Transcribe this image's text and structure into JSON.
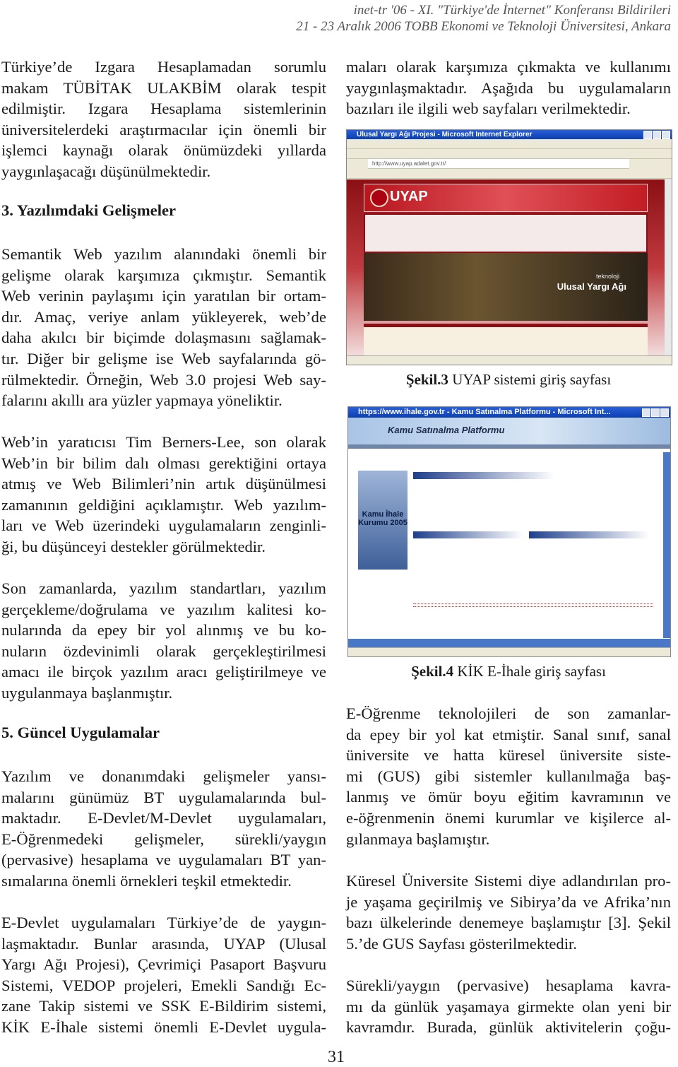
{
  "header": {
    "line1": "inet-tr '06 - XI. \"Türkiye'de İnternet\" Konferansı Bildirileri",
    "line2": "21 - 23 Aralık 2006  TOBB Ekonomi ve Teknoloji Üniversitesi, Ankara"
  },
  "left": {
    "p1": [
      "Türkiye’de Izgara Hesaplamadan sorumlu",
      "makam TÜBİTAK ULAKBİM olarak tespit",
      "edilmiştir. Izgara Hesaplama sistemlerinin",
      "üniversitelerdeki araştırmacılar için önemli bir",
      "işlemci kaynağı olarak önümüzdeki yıllarda",
      "yaygınlaşacağı düşünülmektedir."
    ],
    "heading3": "3. Yazılımdaki Gelişmeler",
    "p2": [
      "Semantik Web yazılım alanındaki önemli bir",
      "gelişme olarak karşımıza çıkmıştır. Semantik",
      "Web verinin paylaşımı için yaratılan bir ortam-",
      "dır. Amaç, veriye anlam yükleyerek, web’de",
      "daha akılcı bir biçimde dolaşmasını sağlamak-",
      "tır. Diğer bir gelişme ise Web sayfalarında gö-",
      "rülmektedir. Örneğin, Web 3.0 projesi Web say-",
      "falarını akıllı ara yüzler yapmaya yöneliktir."
    ],
    "p3": [
      "Web’in yaratıcısı Tim Berners-Lee, son olarak",
      "Web’in bir bilim dalı olması gerektiğini ortaya",
      "atmış ve Web Bilimleri’nin artık düşünülmesi",
      "zamanının geldiğini açıklamıştır. Web yazılım-",
      "ları ve Web üzerindeki uygulamaların zenginli-",
      "ği, bu düşünceyi destekler görülmektedir."
    ],
    "p4": [
      "Son zamanlarda, yazılım standartları, yazılım",
      "gerçekleme/doğrulama ve yazılım kalitesi ko-",
      "nularında da epey bir yol alınmış ve bu ko-",
      "nuların özdevinimli olarak gerçekleştirilmesi",
      "amacı ile birçok yazılım aracı geliştirilmeye ve",
      "uygulanmaya başlanmıştır."
    ],
    "heading5": "5. Güncel Uygulamalar",
    "p5": [
      "Yazılım ve donanımdaki gelişmeler yansı-",
      "malarını günümüz BT uygulamalarında bul-",
      "maktadır. E-Devlet/M-Devlet uygulamaları,",
      "E-Öğrenmedeki gelişmeler, sürekli/yaygın",
      "(pervasive) hesaplama ve uygulamaları BT yan-",
      "sımalarına önemli örnekleri teşkil etmektedir."
    ],
    "p6": [
      "E-Devlet uygulamaları Türkiye’de de yaygın-",
      "laşmaktadır. Bunlar arasında, UYAP (Ulusal",
      "Yargı Ağı Projesi), Çevrimiçi Pasaport Başvuru",
      "Sistemi, VEDOP projeleri, Emekli Sandığı Ec-",
      "zane Takip sistemi ve SSK E-Bildirim sistemi,",
      "KİK E-İhale sistemi önemli E-Devlet uygula-"
    ]
  },
  "right": {
    "p1": [
      "maları olarak karşımıza çıkmakta ve kullanımı",
      "yaygınlaşmaktadır. Aşağıda bu uygulamaların",
      "bazıları ile ilgili web sayfaları verilmektedir."
    ],
    "figure3": {
      "window_title": "Ulusal Yargı Ağı Projesi - Microsoft Internet Explorer",
      "address": "http://www.uyap.adalet.gov.tr/",
      "logo": "UYAP",
      "banner_text1": "teknoloji",
      "banner_text2": "Ulusal Yargı Ağı",
      "caption_label": "Şekil.3",
      "caption_text": " UYAP sistemi giriş sayfası"
    },
    "figure4": {
      "window_title": "https://www.ihale.gov.tr - Kamu Satınalma Platformu - Microsoft Int...",
      "site_title": "Kamu Satınalma Platformu",
      "side_text": "Kamu İhale Kurumu 2005",
      "caption_label": "Şekil.4",
      "caption_text": " KİK E-İhale giriş sayfası"
    },
    "p2": [
      "E-Öğrenme teknolojileri de son zamanlar-",
      "da epey bir yol kat etmiştir. Sanal sınıf, sanal",
      "üniversite ve hatta küresel üniversite siste-",
      "mi (GUS) gibi sistemler kullanılmağa baş-",
      "lanmış ve ömür boyu eğitim kavramının ve",
      "e-öğrenmenin önemi kurumlar ve kişilerce al-",
      "gılanmaya başlamıştır."
    ],
    "p3": [
      "Küresel Üniversite Sistemi diye adlandırılan pro-",
      "je yaşama geçirilmiş ve Sibirya’da ve Afrika’nın",
      "bazı ülkelerinde denemeye başlamıştır [3]. Şekil",
      "5.’de GUS Sayfası gösterilmektedir."
    ],
    "p4": [
      "Sürekli/yaygın (pervasive) hesaplama kavra-",
      "mı da günlük yaşamaya girmekte olan yeni bir",
      "kavramdır. Burada, günlük aktivitelerin çoğu-"
    ]
  },
  "page_number": "31"
}
